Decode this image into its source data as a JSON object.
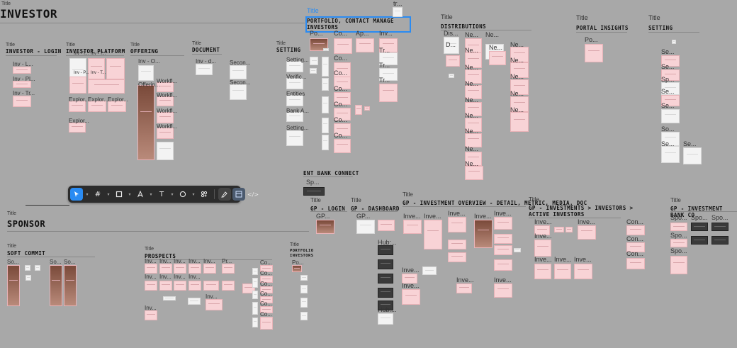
{
  "big_titles": {
    "investor": "INVESTOR",
    "sponsor": "SPONSOR"
  },
  "title_word": "Title",
  "headers": {
    "investor_login": "INVESTOR - LOGIN",
    "investor_platform": "INVESTOR PLATFORM",
    "offering": "OFFERING",
    "document": "DOCUMENT",
    "setting": "SETTING",
    "portfolio_l1": "PORTFOLIO, CONTACT MANAGE",
    "portfolio_l2": "INVESTORS",
    "distributions": "DISTRIBUTIONS",
    "portal_insights": "PORTAL INSIGHTS",
    "setting_right": "SETTING",
    "ent_bank": "ENT BANK CONNECT",
    "gp_login": "GP - LOGIN",
    "gp_dashboard": "GP - DASHBOARD",
    "gp_overview": "GP - INVESTMENT OVERVIEW - DETAIL, METRIC, MEDIA, DOC",
    "gp_investments_l1": "GP - INVESTMENTS > INVESTORS >",
    "gp_investments_l2": "ACTIVE INVESTORS",
    "gp_bank": "GP - INVESTMENT BANK CO",
    "soft_commit": "SOFT COMMIT",
    "prospects": "PROSPECTS",
    "portfolio_small_l1": "PORTFOLIO",
    "portfolio_small_l2": "INVESTORS"
  },
  "frame_labels": {
    "inv_l": "Inv - L...",
    "inv_pl": "Inv - Pl...",
    "inv_tr": "Inv - Tr...",
    "inv_o": "Inv - O...",
    "inv_t": "Inv - T...",
    "inv_p": "Inv - P...",
    "inv_d": "Inv - d...",
    "offering": "Offerin...",
    "workfl": "Workfl...",
    "explor": "Explor...",
    "explor2": "Explor...",
    "secon": "Secon...",
    "setting": "Setting...",
    "verific": "Verific...",
    "entities": "Entities",
    "bank": "Bank A...",
    "po": "Po...",
    "co": "Co...",
    "ap": "Ap...",
    "inv": "Inv...",
    "tr": "tr...",
    "tr2": "Tr...",
    "dis": "Dis...",
    "d": "D...",
    "ne": "Ne...",
    "se": "Se...",
    "sp": "Sp...",
    "gp": "GP...",
    "hub": "Hub:...",
    "inve": "Inve...",
    "con": "Con...",
    "spo": "Spo...",
    "so": "So...",
    "pr": "Pr..."
  },
  "toolbar": {
    "move": "move-tool",
    "frame": "frame-tool",
    "shape": "shape-tool",
    "pen": "pen-tool",
    "text": "T",
    "comment": "comment-tool",
    "actions": "actions-tool",
    "draw": "draw-mode",
    "design": "design-mode",
    "dev": "</>"
  }
}
